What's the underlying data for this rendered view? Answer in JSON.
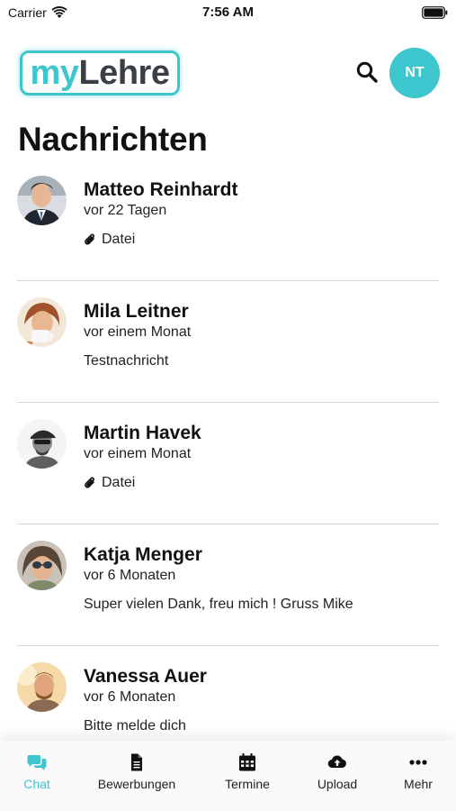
{
  "status_bar": {
    "carrier": "Carrier",
    "time": "7:56 AM"
  },
  "header": {
    "logo_part1": "my",
    "logo_part2": "Lehre",
    "avatar_initials": "NT"
  },
  "page": {
    "title": "Nachrichten"
  },
  "conversations": [
    {
      "name": "Matteo Reinhardt",
      "time": "vor 22 Tagen",
      "preview": "Datei",
      "attachment": true
    },
    {
      "name": "Mila Leitner",
      "time": "vor einem Monat",
      "preview": "Testnachricht",
      "attachment": false
    },
    {
      "name": "Martin Havek",
      "time": "vor einem Monat",
      "preview": "Datei",
      "attachment": true
    },
    {
      "name": "Katja Menger",
      "time": "vor 6 Monaten",
      "preview": "Super vielen Dank, freu mich ! Gruss Mike",
      "attachment": false
    },
    {
      "name": "Vanessa Auer",
      "time": "vor 6 Monaten",
      "preview": "Bitte melde dich",
      "attachment": false
    }
  ],
  "tabs": [
    {
      "label": "Chat",
      "icon": "chat-icon",
      "active": true
    },
    {
      "label": "Bewerbungen",
      "icon": "document-icon",
      "active": false
    },
    {
      "label": "Termine",
      "icon": "calendar-icon",
      "active": false
    },
    {
      "label": "Upload",
      "icon": "cloud-upload-icon",
      "active": false
    },
    {
      "label": "Mehr",
      "icon": "more-icon",
      "active": false
    }
  ],
  "colors": {
    "accent": "#3ec6cf",
    "logo_dark": "#3a3f45",
    "text": "#111111",
    "divider": "#d6d6d6"
  }
}
